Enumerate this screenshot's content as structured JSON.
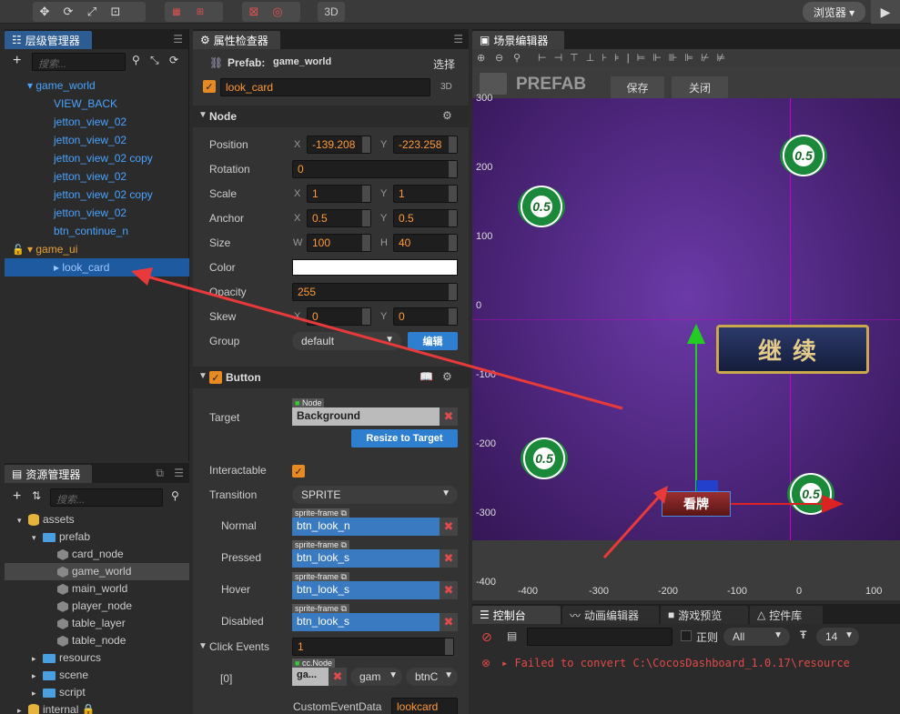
{
  "toolbar": {
    "browser_label": "浏览器 ▾",
    "three_d_label": "3D",
    "play_icon": "play-icon"
  },
  "hierarchy": {
    "tab_label": "层级管理器",
    "search_placeholder": "搜索...",
    "items": [
      {
        "label": "▾ game_world",
        "indent": 0,
        "color": "blue"
      },
      {
        "label": "VIEW_BACK",
        "indent": 1,
        "color": "blue"
      },
      {
        "label": "jetton_view_02",
        "indent": 1,
        "color": "blue"
      },
      {
        "label": "jetton_view_02",
        "indent": 1,
        "color": "blue"
      },
      {
        "label": "jetton_view_02 copy",
        "indent": 1,
        "color": "blue"
      },
      {
        "label": "jetton_view_02",
        "indent": 1,
        "color": "blue"
      },
      {
        "label": "jetton_view_02 copy",
        "indent": 1,
        "color": "blue"
      },
      {
        "label": "jetton_view_02",
        "indent": 1,
        "color": "blue"
      },
      {
        "label": "btn_continue_n",
        "indent": 1,
        "color": "blue"
      },
      {
        "label": "▾ game_ui",
        "indent": 0,
        "color": "orange"
      },
      {
        "label": "▸ look_card",
        "indent": 1,
        "color": "selected"
      }
    ]
  },
  "assets": {
    "tab_label": "资源管理器",
    "search_placeholder": "搜索...",
    "items": [
      {
        "label": "assets",
        "indent": 0,
        "icon": "db",
        "arrow": "▾"
      },
      {
        "label": "prefab",
        "indent": 1,
        "icon": "folder",
        "arrow": "▾"
      },
      {
        "label": "card_node",
        "indent": 2,
        "icon": "cube",
        "arrow": ""
      },
      {
        "label": "game_world",
        "indent": 2,
        "icon": "cube",
        "arrow": "",
        "hl": true
      },
      {
        "label": "main_world",
        "indent": 2,
        "icon": "cube",
        "arrow": ""
      },
      {
        "label": "player_node",
        "indent": 2,
        "icon": "cube",
        "arrow": ""
      },
      {
        "label": "table_layer",
        "indent": 2,
        "icon": "cube",
        "arrow": ""
      },
      {
        "label": "table_node",
        "indent": 2,
        "icon": "cube",
        "arrow": ""
      },
      {
        "label": "resourcs",
        "indent": 1,
        "icon": "folder",
        "arrow": "▸"
      },
      {
        "label": "scene",
        "indent": 1,
        "icon": "folder",
        "arrow": "▸"
      },
      {
        "label": "script",
        "indent": 1,
        "icon": "folder",
        "arrow": "▸"
      },
      {
        "label": "internal 🔒",
        "indent": 0,
        "icon": "db",
        "arrow": "▸"
      }
    ]
  },
  "inspector": {
    "tab_label": "属性检查器",
    "prefab_label": "Prefab:",
    "prefab_name": "game_world",
    "prefab_select": "选择",
    "node_name": "look_card",
    "three_d": "3D",
    "node_section": "Node",
    "position_label": "Position",
    "pos_x": "-139.208",
    "pos_y": "-223.258",
    "rotation_label": "Rotation",
    "rotation": "0",
    "scale_label": "Scale",
    "scale_x": "1",
    "scale_y": "1",
    "anchor_label": "Anchor",
    "anchor_x": "0.5",
    "anchor_y": "0.5",
    "size_label": "Size",
    "size_w": "100",
    "size_h": "40",
    "color_label": "Color",
    "color_value": "#ffffff",
    "opacity_label": "Opacity",
    "opacity": "255",
    "skew_label": "Skew",
    "skew_x": "0",
    "skew_y": "0",
    "group_label": "Group",
    "group_value": "default",
    "group_edit": "编辑",
    "axis_x": "X",
    "axis_y": "Y",
    "axis_w": "W",
    "axis_h": "H",
    "button_section": "Button",
    "target_label": "Target",
    "node_tag": "Node",
    "target_value": "Background",
    "resize_btn": "Resize to Target",
    "interactable_label": "Interactable",
    "transition_label": "Transition",
    "transition_value": "SPRITE",
    "sprite_tag": "sprite-frame",
    "normal_label": "Normal",
    "normal_value": "btn_look_n",
    "pressed_label": "Pressed",
    "pressed_value": "btn_look_s",
    "hover_label": "Hover",
    "hover_value": "btn_look_s",
    "disabled_label": "Disabled",
    "disabled_value": "btn_look_s",
    "click_events_label": "Click Events",
    "click_events_count": "1",
    "event_index": "[0]",
    "ccnode_tag": "cc.Node",
    "event_node": "ga...",
    "event_comp": "gam",
    "event_handler": "btnC",
    "custom_label": "CustomEventData",
    "custom_value": "lookcard"
  },
  "scene": {
    "tab_label": "场景编辑器",
    "prefab_title": "PREFAB",
    "save_btn": "保存",
    "close_btn": "关闭",
    "y_labels": [
      "300",
      "200",
      "100",
      "0",
      "-100",
      "-200",
      "-300",
      "-400"
    ],
    "x_labels": [
      "-400",
      "-300",
      "-200",
      "-100",
      "0",
      "100"
    ],
    "chip_label": "0.5",
    "continue_text": "继续",
    "look_text": "看牌"
  },
  "console": {
    "tabs": [
      "控制台",
      "动画编辑器",
      "游戏预览",
      "控件库"
    ],
    "regex_label": "正则",
    "level_value": "All",
    "font_size": "14",
    "error_text": "▸ Failed to convert C:\\CocosDashboard_1.0.17\\resource"
  }
}
